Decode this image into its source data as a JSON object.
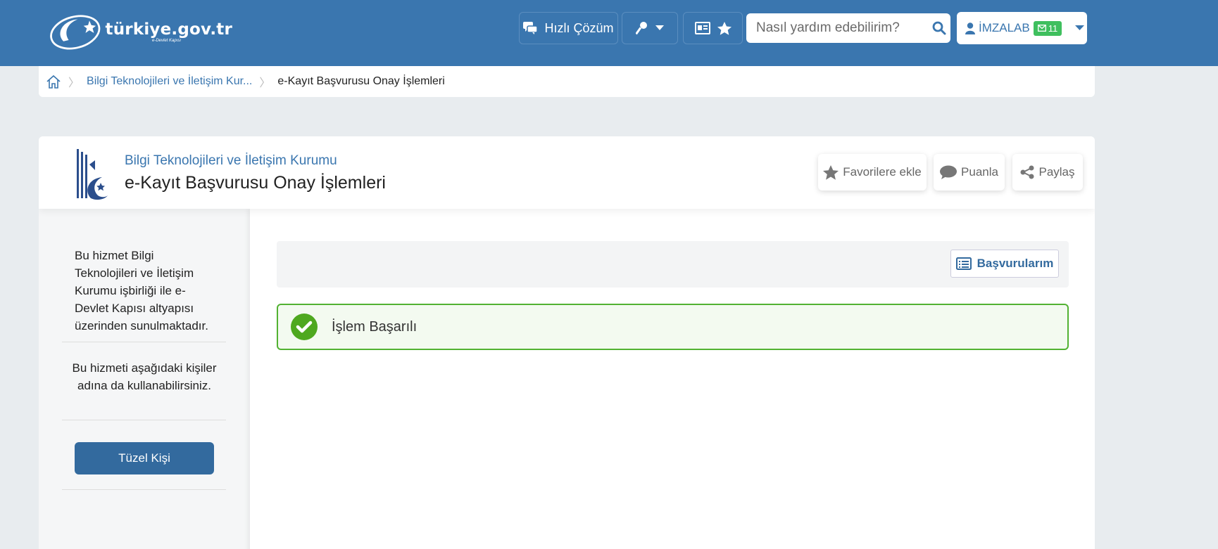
{
  "header": {
    "logo_text": "türkiye.gov.tr",
    "logo_subtext": "e-Devlet Kapısı",
    "quick_solution_label": "Hızlı Çözüm",
    "search_placeholder": "Nasıl yardım edebilirim?",
    "user_name": "İMZALAB",
    "message_count": "11",
    "colors": {
      "primary": "#3a76af",
      "success": "#52b232",
      "badge": "#3fbf5e"
    }
  },
  "breadcrumb": {
    "items": [
      "Bilgi Teknolojileri ve İletişim Kur...",
      "e-Kayıt Başvurusu Onay İşlemleri"
    ]
  },
  "service": {
    "institution": "Bilgi Teknolojileri ve İletişim Kurumu",
    "title": "e-Kayıt Başvurusu Onay İşlemleri",
    "actions": {
      "favorite": "Favorilere ekle",
      "rate": "Puanla",
      "share": "Paylaş"
    }
  },
  "sidebar": {
    "info_text": "Bu hizmet Bilgi Teknolojileri ve İletişim Kurumu işbirliği ile e-Devlet Kapısı altyapısı üzerinden sunulmaktadır.",
    "behalf_text": "Bu hizmeti aşağıdaki kişiler adına da kullanabilirsiniz.",
    "legal_entity_button": "Tüzel Kişi"
  },
  "content": {
    "applications_button": "Başvurularım",
    "success_message": "İşlem Başarılı"
  }
}
